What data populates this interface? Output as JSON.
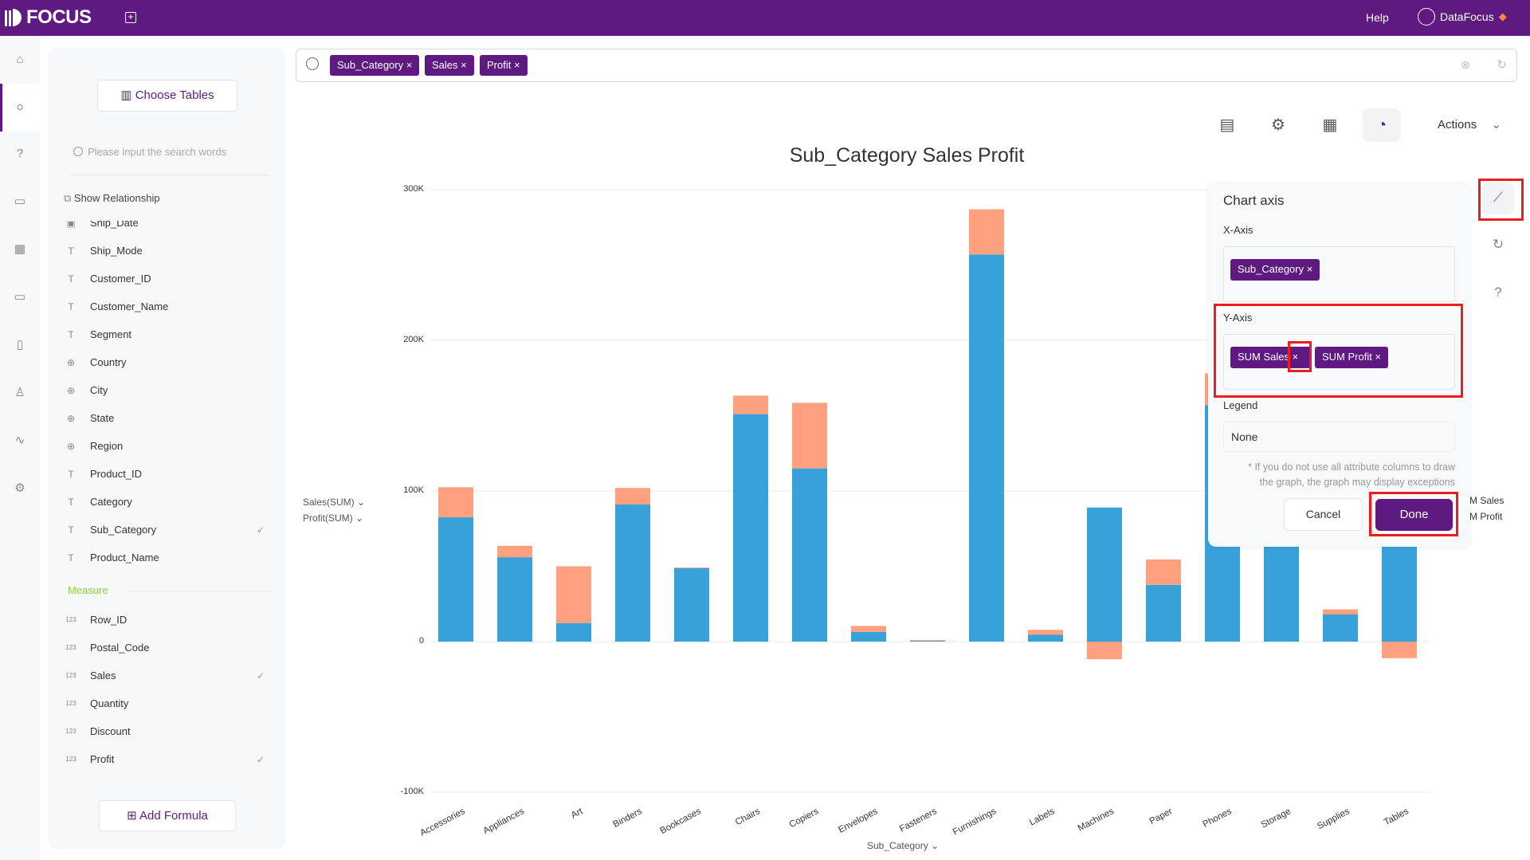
{
  "topbar": {
    "brand": "FOCUS",
    "help": "Help",
    "user": "DataFocus"
  },
  "left_panel": {
    "choose_tables": "Choose Tables",
    "search_placeholder": "Please input the search words",
    "show_relationship": "Show Relationship",
    "attributes": [
      {
        "label": "Ship_Date",
        "icon": "date",
        "checked": false
      },
      {
        "label": "Ship_Mode",
        "icon": "text",
        "checked": false
      },
      {
        "label": "Customer_ID",
        "icon": "text",
        "checked": false
      },
      {
        "label": "Customer_Name",
        "icon": "text",
        "checked": false
      },
      {
        "label": "Segment",
        "icon": "text",
        "checked": false
      },
      {
        "label": "Country",
        "icon": "globe",
        "checked": false
      },
      {
        "label": "City",
        "icon": "globe",
        "checked": false
      },
      {
        "label": "State",
        "icon": "globe",
        "checked": false
      },
      {
        "label": "Region",
        "icon": "globe",
        "checked": false
      },
      {
        "label": "Product_ID",
        "icon": "text",
        "checked": false
      },
      {
        "label": "Category",
        "icon": "text",
        "checked": false
      },
      {
        "label": "Sub_Category",
        "icon": "text",
        "checked": true
      },
      {
        "label": "Product_Name",
        "icon": "text",
        "checked": false
      }
    ],
    "measure_heading": "Measure",
    "measures": [
      {
        "label": "Row_ID",
        "icon": "123",
        "checked": false
      },
      {
        "label": "Postal_Code",
        "icon": "123",
        "checked": false
      },
      {
        "label": "Sales",
        "icon": "123",
        "checked": true
      },
      {
        "label": "Quantity",
        "icon": "123",
        "checked": false
      },
      {
        "label": "Discount",
        "icon": "123",
        "checked": false
      },
      {
        "label": "Profit",
        "icon": "123",
        "checked": true
      }
    ],
    "add_formula": "Add Formula"
  },
  "search": {
    "tokens": [
      "Sub_Category",
      "Sales",
      "Profit"
    ]
  },
  "toolbar": {
    "actions": "Actions"
  },
  "colors": {
    "brand": "#5e1a80",
    "sales": "#37a2da",
    "profit": "#ffa07f",
    "highlight": "#ee1c1c",
    "measure": "#8bcf3b"
  },
  "chart_data": {
    "type": "bar",
    "stacked": true,
    "title": "Sub_Category Sales Profit",
    "xlabel": "Sub_Category",
    "ylim": [
      -100000,
      300000
    ],
    "yticks": [
      "300K",
      "200K",
      "100K",
      "0",
      "-100K"
    ],
    "grid": true,
    "categories": [
      "Accessories",
      "Appliances",
      "Art",
      "Binders",
      "Bookcases",
      "Chairs",
      "Copiers",
      "Envelopes",
      "Fasteners",
      "Furnishings",
      "Labels",
      "Machines",
      "Paper",
      "Phones",
      "Storage",
      "Supplies",
      "Tables"
    ],
    "series": [
      {
        "name": "Sales(SUM)",
        "values": [
          82500,
          56000,
          12300,
          91000,
          48700,
          151000,
          115000,
          6500,
          700,
          257000,
          4500,
          89000,
          37700,
          157000,
          150000,
          18000,
          150000
        ]
      },
      {
        "name": "Profit(SUM)",
        "values": [
          20000,
          7600,
          37700,
          11000,
          500,
          12300,
          43500,
          3900,
          300,
          30000,
          3300,
          -11700,
          16800,
          21000,
          21000,
          3400,
          -11000
        ]
      }
    ],
    "legend_right": [
      "M Sales",
      "M Profit"
    ]
  },
  "axis_panel": {
    "title": "Chart axis",
    "x_label": "X-Axis",
    "x_chips": [
      "Sub_Category"
    ],
    "y_label": "Y-Axis",
    "y_chips": [
      "SUM Sales",
      "SUM Profit"
    ],
    "legend_label": "Legend",
    "legend_value": "None",
    "note_line1": "* If you do not use all attribute columns to draw",
    "note_line2": "the graph, the graph may display exceptions",
    "cancel": "Cancel",
    "done": "Done"
  }
}
